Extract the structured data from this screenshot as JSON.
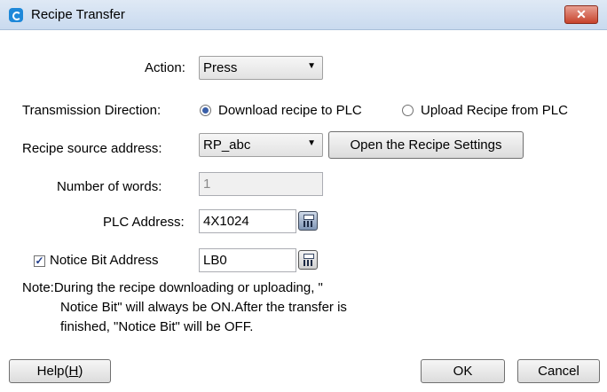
{
  "window": {
    "title": "Recipe Transfer",
    "close_glyph": "✕"
  },
  "action": {
    "label": "Action:",
    "value": "Press"
  },
  "transmission": {
    "label": "Transmission Direction:",
    "option_download": "Download recipe to PLC",
    "option_upload": "Upload Recipe from PLC",
    "selected": "download"
  },
  "recipe_source": {
    "label": "Recipe source address:",
    "value": "RP_abc",
    "open_button": "Open the Recipe Settings"
  },
  "number_of_words": {
    "label": "Number of words:",
    "value": "1"
  },
  "plc_address": {
    "label": "PLC Address:",
    "value": "4X1024"
  },
  "notice_bit": {
    "label": "Notice Bit Address",
    "value": "LB0",
    "checked": true
  },
  "note": {
    "line1": "Note:During the recipe downloading or uploading, \"",
    "line2": "Notice Bit\" will always be ON.After the transfer is",
    "line3": "finished, \"Notice Bit\" will be OFF."
  },
  "buttons": {
    "help_prefix": "Help(",
    "help_key": "H",
    "help_suffix": ")",
    "ok": "OK",
    "cancel": "Cancel"
  },
  "colors": {
    "titlebar": "#c9daef",
    "close": "#c7432c",
    "radio_on": "#3a5fa8"
  }
}
